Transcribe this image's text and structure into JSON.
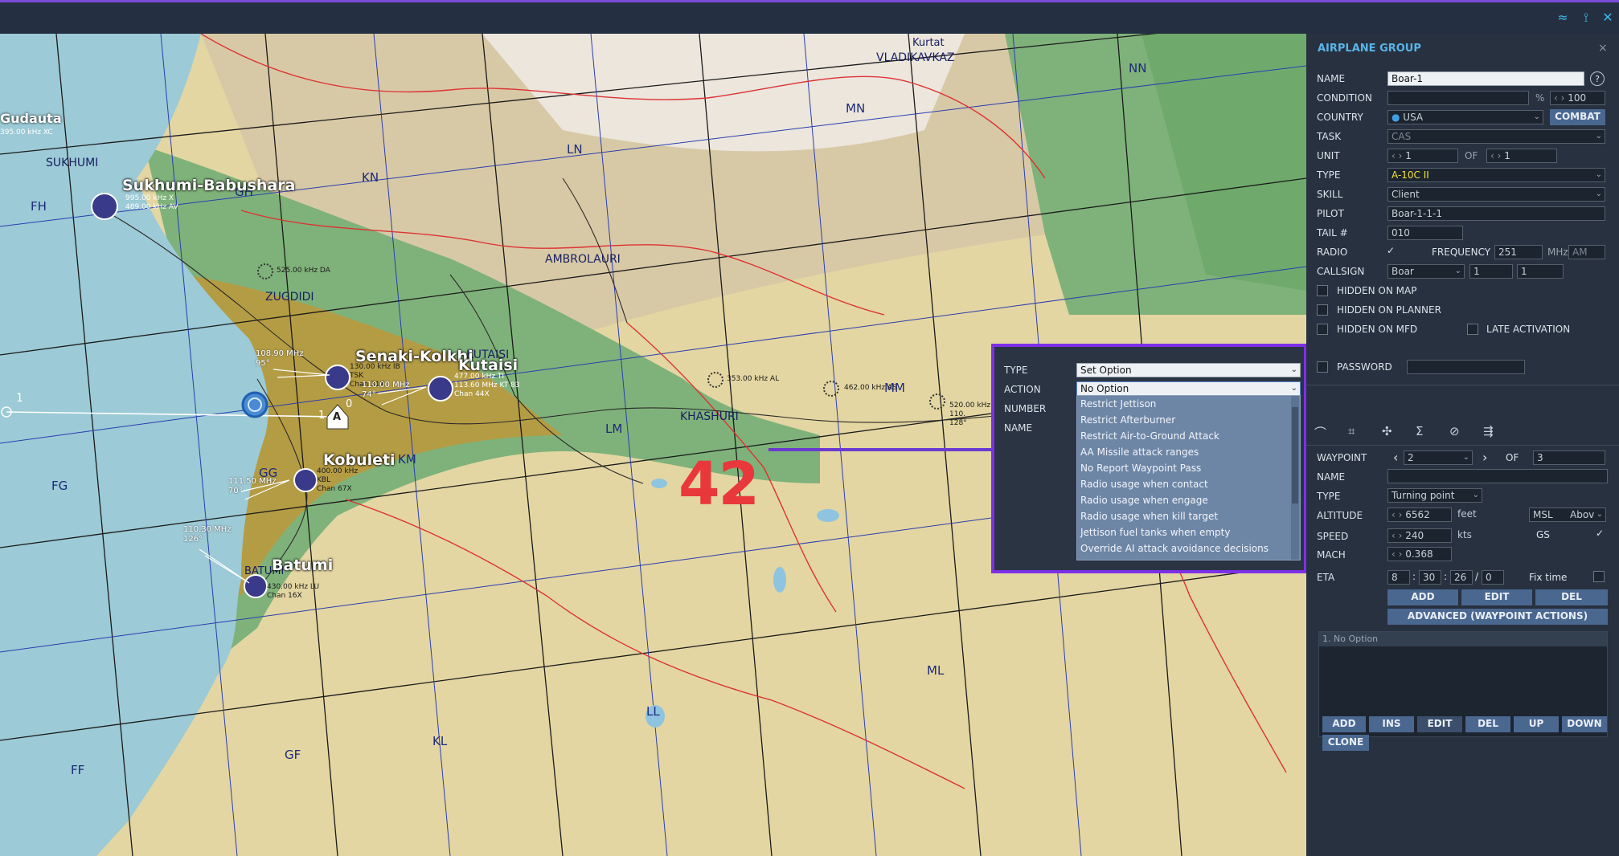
{
  "map": {
    "grid_labels": [
      "FH",
      "GH",
      "KN",
      "LN",
      "MN",
      "NN",
      "FG",
      "GG",
      "KM",
      "LM",
      "MM",
      "FF",
      "GF",
      "KL",
      "LL",
      "ML"
    ],
    "places": [
      "Kurtat",
      "VLADIKAVKAZ",
      "SUKHUMI",
      "AMBROLAURI",
      "ZUGDIDI",
      "KUTAISI",
      "KHASHURI",
      "BATUMI",
      "Gudauta"
    ],
    "airfields": [
      "Sukhumi-Babushara",
      "Senaki-Kolkhi",
      "Kutaisi",
      "Kobuleti",
      "Batumi"
    ],
    "freqs": {
      "gudauta": "395.00 kHz XC",
      "sukhumi": "995.00 kHz X\n489.00 kHz AV",
      "zugdidi": "525.00 kHz DA",
      "senaki_left": "108.90 MHz\n95°",
      "senaki_tac": "130.00 kHz IB\nTSK\nChan 31X",
      "senaki_vor": "110.00 MHz\n74°",
      "kutaisi": "477.00 kHz TI\n113.60 MHz KT 83\nChan 44X",
      "kobuleti_left": "111.50 MHz\n70°",
      "kobuleti": "400.00 kHz\nKBL\nChan 67X",
      "batumi_left": "110.30 MHz\n126°",
      "batumi": "430.00 kHz LU\nChan 16X",
      "khashuri_1": "353.00 kHz AL",
      "khashuri_2": "462.00 kHz AS",
      "east": "520.00 kHz\n110.\n128°"
    },
    "waypoints": {
      "wp0": "0",
      "wp1": "1",
      "wp1b": "1",
      "marker": "A"
    },
    "annotation": "42"
  },
  "panel": {
    "title": "AIRPLANE GROUP",
    "close": "×",
    "labels": {
      "name": "NAME",
      "condition": "CONDITION",
      "country": "COUNTRY",
      "task": "TASK",
      "unit": "UNIT",
      "type": "TYPE",
      "skill": "SKILL",
      "pilot": "PILOT",
      "tail": "TAIL #",
      "radio": "RADIO",
      "frequency": "FREQUENCY",
      "callsign": "CALLSIGN",
      "of": "OF",
      "percent": "%",
      "mhz": "MHz"
    },
    "values": {
      "name": "Boar-1",
      "condition": "100",
      "country": "USA",
      "task": "CAS",
      "unit": "1",
      "unit_of": "1",
      "type": "A-10C II",
      "skill": "Client",
      "pilot": "Boar-1-1-1",
      "tail": "010",
      "frequency": "251",
      "modulation": "AM",
      "callsign": "Boar",
      "callsign_1": "1",
      "callsign_2": "1"
    },
    "combat_button": "COMBAT",
    "help": "?",
    "hidden_on_map": "HIDDEN ON MAP",
    "hidden_on_planner": "HIDDEN ON PLANNER",
    "hidden_on_mfd": "HIDDEN ON MFD",
    "late_activation": "LATE ACTIVATION",
    "password": "PASSWORD",
    "radio_checked": "✓",
    "waypoint": {
      "labels": {
        "waypoint": "WAYPOINT",
        "of": "OF",
        "name": "NAME",
        "type": "TYPE",
        "altitude": "ALTITUDE",
        "feet": "feet",
        "speed": "SPEED",
        "kts": "kts",
        "gs": "GS",
        "mach": "MACH",
        "eta": "ETA",
        "fix_time": "Fix time"
      },
      "values": {
        "waypoint": "2",
        "of": "3",
        "name": "",
        "type": "Turning point",
        "altitude": "6562",
        "alt_ref": "MSL",
        "alt_mode": "Abov",
        "speed": "240",
        "mach": "0.368",
        "eta_d": "8",
        "eta_h": "30",
        "eta_m": "26",
        "eta_s": "0",
        "gs_checked": "✓"
      },
      "buttons": {
        "add": "ADD",
        "edit": "EDIT",
        "del": "DEL",
        "advanced": "ADVANCED (WAYPOINT ACTIONS)"
      },
      "actions_list": [
        "1. No Option"
      ],
      "list_buttons": {
        "add": "ADD",
        "ins": "INS",
        "edit": "EDIT",
        "del": "DEL",
        "up": "UP",
        "down": "DOWN",
        "clone": "CLONE"
      }
    }
  },
  "popup": {
    "labels": {
      "type": "TYPE",
      "action": "ACTION",
      "number": "NUMBER",
      "name": "NAME"
    },
    "type_value": "Set Option",
    "action_value": "No Option",
    "options": [
      "Restrict Jettison",
      "Restrict Afterburner",
      "Restrict Air-to-Ground Attack",
      "AA Missile attack ranges",
      "No Report Waypoint Pass",
      "Radio usage when contact",
      "Radio usage when engage",
      "Radio usage when kill target",
      "Jettison fuel tanks when empty",
      "Override AI attack avoidance decisions"
    ]
  }
}
